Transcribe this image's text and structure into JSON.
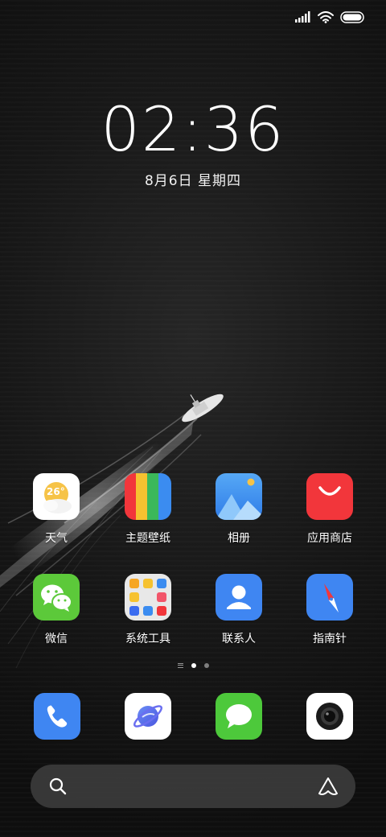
{
  "status_bar": {
    "signal_icon": "cellular-signal-icon",
    "wifi_icon": "wifi-icon",
    "battery_icon": "battery-icon",
    "battery_level": 1.0
  },
  "clock": {
    "time": "02:36",
    "date": "8月6日 星期四"
  },
  "weather_badge": "26°",
  "apps": [
    {
      "label": "天气",
      "icon": "weather-icon"
    },
    {
      "label": "主题壁纸",
      "icon": "themes-icon"
    },
    {
      "label": "相册",
      "icon": "gallery-icon"
    },
    {
      "label": "应用商店",
      "icon": "app-store-icon"
    },
    {
      "label": "微信",
      "icon": "wechat-icon"
    },
    {
      "label": "系统工具",
      "icon": "system-tools-folder-icon"
    },
    {
      "label": "联系人",
      "icon": "contacts-icon"
    },
    {
      "label": "指南针",
      "icon": "compass-icon"
    }
  ],
  "page_indicator": {
    "pages": 2,
    "current": 1
  },
  "dock": [
    {
      "icon": "phone-icon"
    },
    {
      "icon": "browser-icon"
    },
    {
      "icon": "messages-icon"
    },
    {
      "icon": "camera-icon"
    }
  ],
  "search_bar": {
    "search_icon": "search-icon",
    "assistant_icon": "assistant-icon"
  },
  "colors": {
    "weather_yellow": "#f6c347",
    "gallery_blue": "#3b8cf0",
    "store_red": "#f2363b",
    "wechat_green": "#5cc93a",
    "contacts_blue": "#3f86f2",
    "compass_blue": "#3f86f2",
    "phone_blue": "#3f86f2",
    "messages_green": "#4dc93b"
  }
}
